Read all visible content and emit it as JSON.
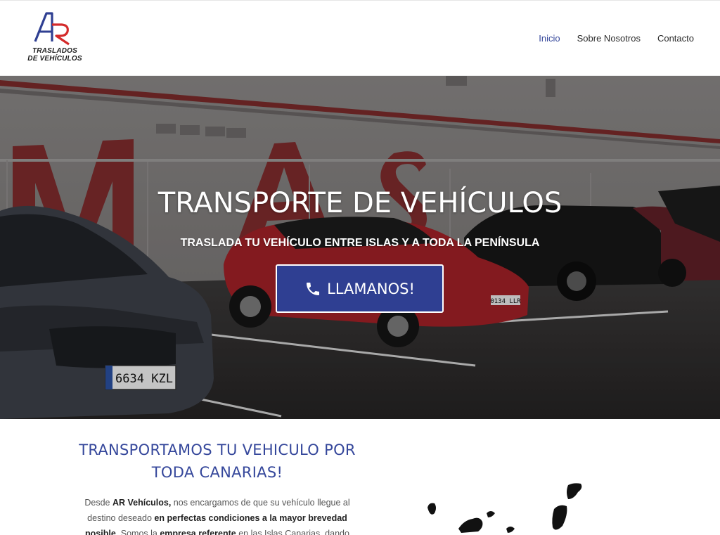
{
  "logo": {
    "text_line1": "TRASLADOS",
    "text_line2": "DE VEHÍCULOS"
  },
  "nav": {
    "items": [
      {
        "label": "Inicio",
        "active": true
      },
      {
        "label": "Sobre Nosotros",
        "active": false
      },
      {
        "label": "Contacto",
        "active": false
      }
    ]
  },
  "hero": {
    "title": "TRANSPORTE DE VEHÍCULOS",
    "subtitle": "TRASLADA TU VEHÍCULO ENTRE ISLAS Y A TODA LA PENÍNSULA",
    "cta_label": "LLAMANOS!",
    "cta_icon": "phone-icon",
    "plate_1": "6634 KZL",
    "plate_2": "0134 LLR"
  },
  "content": {
    "title_line1": "TRANSPORTAMOS TU VEHICULO POR",
    "title_line2": "TODA CANARIAS!",
    "p_1": "Desde ",
    "p_2": "AR Vehículos,",
    "p_3": " nos encargamos de que su vehículo llegue al destino deseado ",
    "p_4": "en perfectas condiciones a la mayor brevedad posible.",
    "p_5": " Somos la ",
    "p_6": "empresa referente",
    "p_7": " en las Islas Canarias, dando"
  },
  "colors": {
    "brand_blue": "#35479b",
    "cta_blue": "#2f3f92",
    "logo_red": "#d42a2a"
  }
}
